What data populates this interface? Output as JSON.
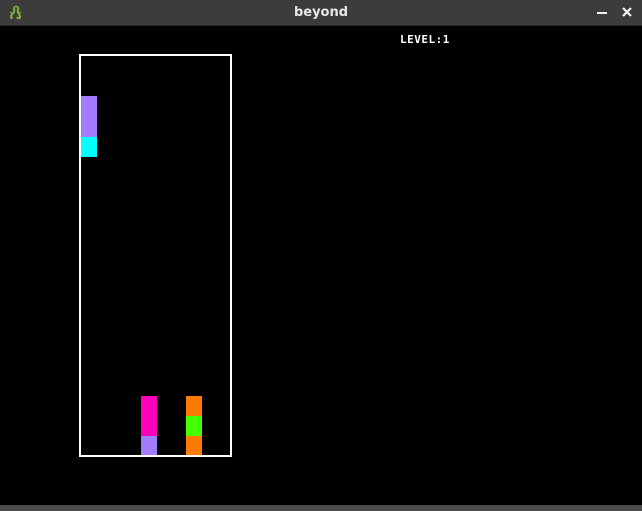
{
  "window": {
    "title": "beyond",
    "icon": "gecko-icon"
  },
  "hud": {
    "level_text": "LEVEL:1"
  },
  "colors": {
    "purple": "#a37bff",
    "cyan": "#00ffff",
    "magenta": "#ff00bb",
    "orange": "#ff7b00",
    "green": "#44ff00",
    "well_border": "#ffffff",
    "background": "#000000"
  },
  "board": {
    "falling_piece": [
      "purple",
      "purple",
      "cyan"
    ],
    "stacked_columns": [
      {
        "column": 4,
        "cells": [
          "magenta",
          "magenta",
          "purple"
        ]
      },
      {
        "column": 7,
        "cells": [
          "orange",
          "green",
          "orange"
        ]
      }
    ]
  }
}
